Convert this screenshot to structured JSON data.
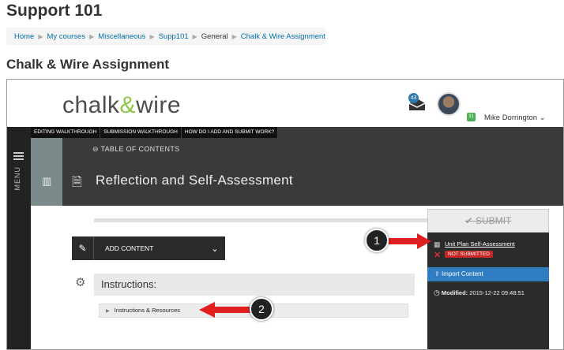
{
  "site_title": "Support 101",
  "breadcrumbs": [
    "Home",
    "My courses",
    "Miscellaneous",
    "Supp101",
    "General",
    "Chalk & Wire Assignment"
  ],
  "page_heading": "Chalk & Wire Assignment",
  "cw": {
    "logo_text_a": "chalk",
    "logo_text_amp": "&",
    "logo_text_b": "wire",
    "inbox_count": "43",
    "user_badge": "31",
    "user_name": "Mike Dorrington",
    "walkthrough_tabs": [
      "EDITING WALKTHROUGH",
      "SUBMISSION WALKTHROUGH",
      "HOW DO I ADD AND SUBMIT WORK?"
    ],
    "menu_label": "MENU",
    "toc_label": "TABLE OF CONTENTS",
    "section_title": "Reflection and Self-Assessment",
    "add_content_label": "ADD CONTENT",
    "instructions_label": "Instructions:",
    "instructions_sub": "Instructions & Resources",
    "submit_label": "SUBMIT",
    "plan_link": "Unit Plan Self-Assessment",
    "status_badge": "NOT SUBMITTED",
    "import_label": "Import Content",
    "modified_label": "Modified:",
    "modified_value": "2015-12-22 09:48:51"
  },
  "callouts": [
    "1",
    "2"
  ],
  "colors": {
    "accent_green": "#8cc63f",
    "link_blue": "#0070a8",
    "import_blue": "#2f7cc1",
    "status_red": "#c62828",
    "arrow_red": "#e02020"
  }
}
